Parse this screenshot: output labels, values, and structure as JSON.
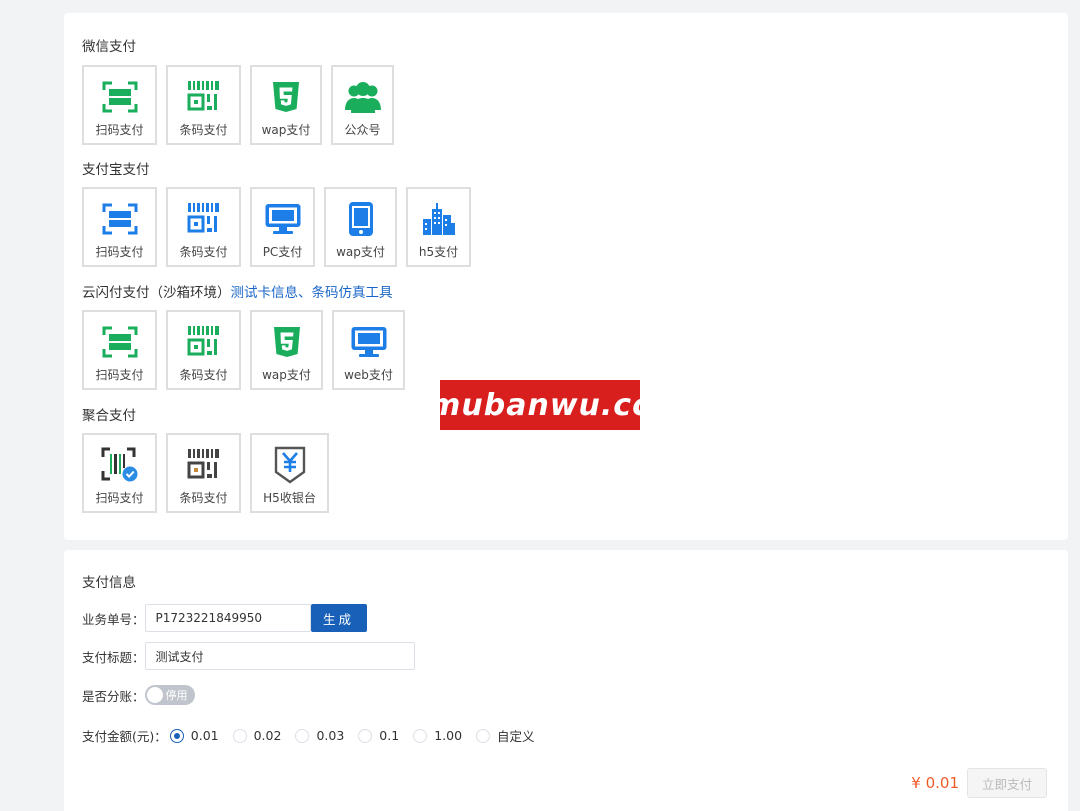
{
  "groups": [
    {
      "title": "微信支付",
      "items": [
        {
          "label": "扫码支付",
          "icon": "scan-icon"
        },
        {
          "label": "条码支付",
          "icon": "barcode-icon"
        },
        {
          "label": "wap支付",
          "icon": "html5-icon"
        },
        {
          "label": "公众号",
          "icon": "users-icon"
        }
      ]
    },
    {
      "title": "支付宝支付",
      "items": [
        {
          "label": "扫码支付",
          "icon": "scan-icon"
        },
        {
          "label": "条码支付",
          "icon": "barcode-icon"
        },
        {
          "label": "PC支付",
          "icon": "monitor-icon"
        },
        {
          "label": "wap支付",
          "icon": "phone-icon"
        },
        {
          "label": "h5支付",
          "icon": "building-icon"
        }
      ]
    },
    {
      "title": "云闪付支付（沙箱环境）",
      "links": "测试卡信息、条码仿真工具",
      "items": [
        {
          "label": "扫码支付",
          "icon": "scan-icon"
        },
        {
          "label": "条码支付",
          "icon": "barcode-icon"
        },
        {
          "label": "wap支付",
          "icon": "html5-icon"
        },
        {
          "label": "web支付",
          "icon": "monitor-icon"
        }
      ]
    },
    {
      "title": "聚合支付",
      "items": [
        {
          "label": "扫码支付",
          "icon": "scan-check-icon"
        },
        {
          "label": "条码支付",
          "icon": "barcode-icon"
        },
        {
          "label": "H5收银台",
          "icon": "yuan-tag-icon"
        }
      ]
    }
  ],
  "watermark": "mubanwu.cc",
  "form": {
    "title": "支付信息",
    "order_label": "业务单号：",
    "order_value": "P1723221849950",
    "gen_label": "生成",
    "subject_label": "支付标题：",
    "subject_value": "测试支付",
    "split_label": "是否分账：",
    "split_state": "停用",
    "amount_label": "支付金额(元)：",
    "amounts": [
      "0.01",
      "0.02",
      "0.03",
      "0.1",
      "1.00",
      "自定义"
    ],
    "selected_amount": "0.01",
    "price_display": "¥ 0.01",
    "pay_label": "立即支付"
  },
  "colors": {
    "wechat": "#1aad5b",
    "alipay": "#1d7ee8",
    "primary": "#1961b8",
    "price": "#ee5b2b"
  }
}
